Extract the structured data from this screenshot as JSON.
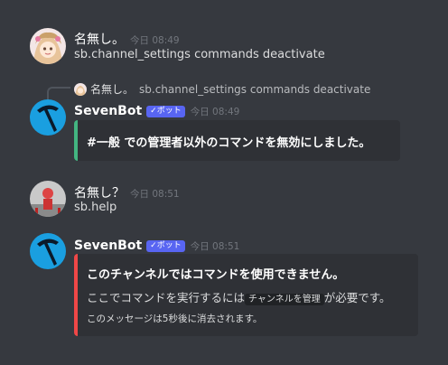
{
  "messages": [
    {
      "author": "名無し。",
      "timestamp": "今日 08:49",
      "content": "sb.channel_settings commands deactivate",
      "avatar_icon": "anime-girl-avatar"
    },
    {
      "reply": {
        "author": "名無し。",
        "content": "sb.channel_settings commands deactivate"
      },
      "author": "SevenBot",
      "bot_tag": "✓ボット",
      "timestamp": "今日 08:49",
      "avatar_icon": "pickaxe-avatar",
      "embed": {
        "color": "#43b581",
        "title_channel": "#一般",
        "title_rest": " での管理者以外のコマンドを無効にしました。"
      }
    },
    {
      "author": "名無し？",
      "timestamp": "今日 08:51",
      "content": "sb.help",
      "avatar_icon": "red-figure-avatar"
    },
    {
      "author": "SevenBot",
      "bot_tag": "✓ボット",
      "timestamp": "今日 08:51",
      "avatar_icon": "pickaxe-avatar",
      "embed": {
        "color": "#f04747",
        "title": "このチャンネルではコマンドを使用できません。",
        "desc_before": "ここでコマンドを実行するには",
        "desc_code": "チャンネルを管理",
        "desc_after": "が必要です。",
        "footer": "このメッセージは5秒後に消去されます。"
      }
    }
  ]
}
